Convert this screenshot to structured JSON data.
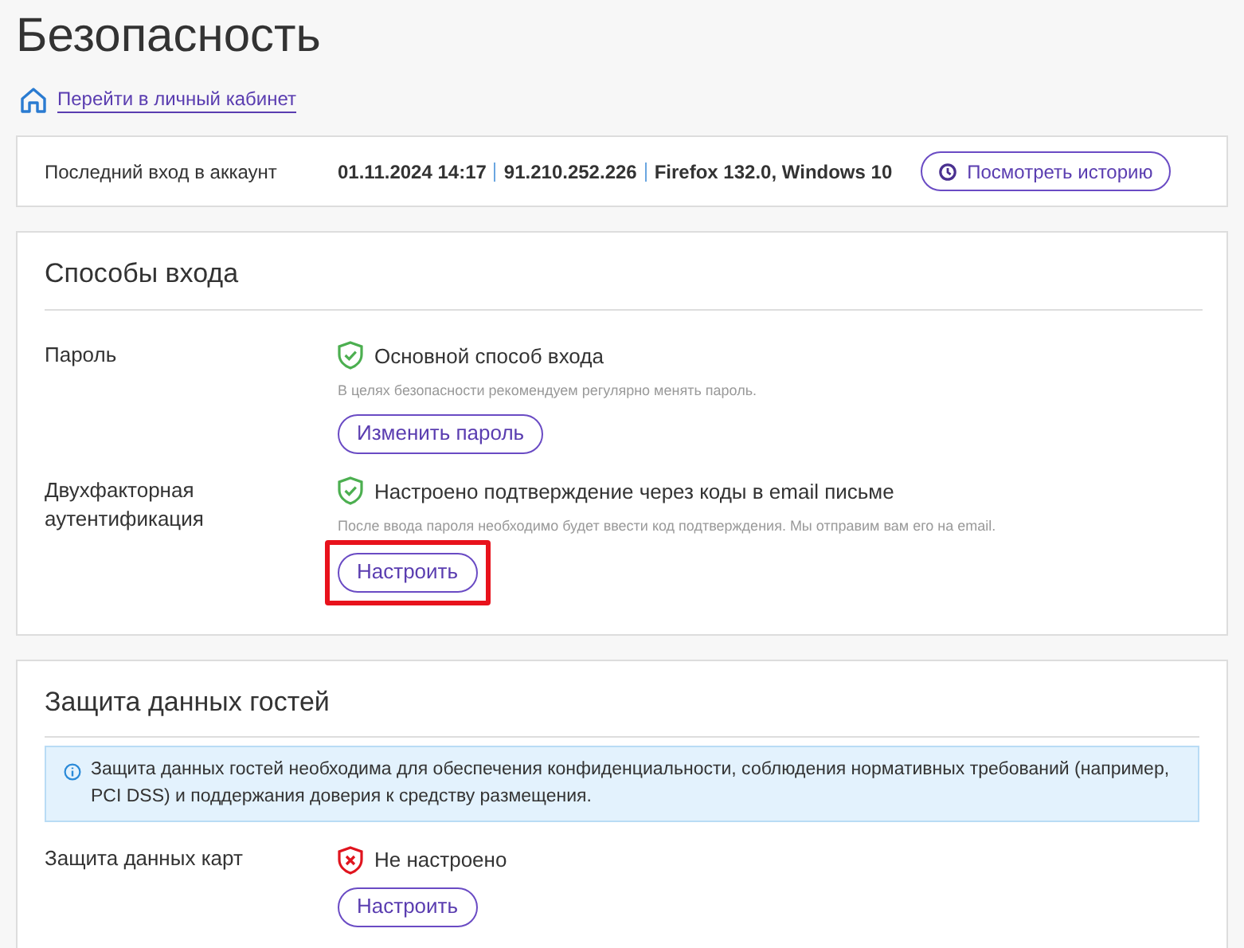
{
  "title": "Безопасность",
  "home_link": "Перейти в личный кабинет",
  "last_login": {
    "label": "Последний вход в аккаунт",
    "parts": [
      "01.11.2024 14:17",
      "91.210.252.226",
      "Firefox 132.0, Windows 10"
    ],
    "button": "Посмотреть историю"
  },
  "login_methods": {
    "heading": "Способы входа",
    "rows": [
      {
        "label": "Пароль",
        "kind": "ok",
        "status_text": "Основной способ входа",
        "hint": "В целях безопасности рекомендуем регулярно менять пароль.",
        "button": "Изменить пароль",
        "highlighted": false
      },
      {
        "label": "Двухфакторная аутентификация",
        "kind": "ok",
        "status_text": "Настроено подтверждение через коды в email письме",
        "hint": "После ввода пароля необходимо будет ввести код подтверждения. Мы отправим вам его на email.",
        "button": "Настроить",
        "highlighted": true
      }
    ]
  },
  "guest_data": {
    "heading": "Защита данных гостей",
    "info": "Защита данных гостей необходима для обеспечения конфиденциальности, соблюдения нормативных требований (например, PCI DSS) и поддержания доверия к средству размещения.",
    "rows": [
      {
        "label": "Защита данных карт",
        "kind": "error",
        "status_text": "Не настроено",
        "button": "Настроить",
        "highlighted": false
      }
    ]
  }
}
